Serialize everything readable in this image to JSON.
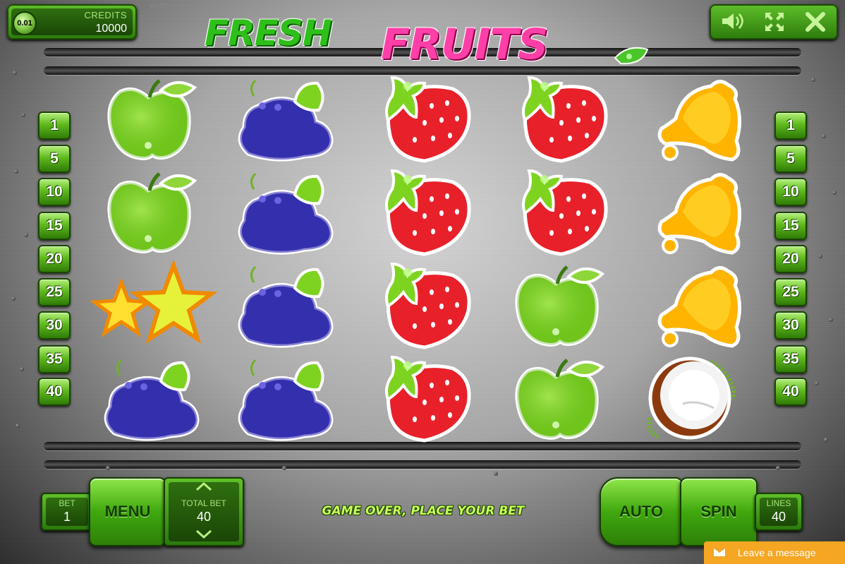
{
  "header": {
    "brand": "endorphina",
    "coin_value": "0.01",
    "credits_label": "CREDITS",
    "credits_value": "10000",
    "logo_word1": "FRESH",
    "logo_word2": "FRUITS",
    "controls": [
      {
        "name": "sound-icon",
        "glyph": "🔈"
      },
      {
        "name": "fullscreen-icon",
        "glyph": "⤢"
      },
      {
        "name": "close-icon",
        "glyph": "✕"
      }
    ]
  },
  "lines_left": [
    "1",
    "5",
    "10",
    "15",
    "20",
    "25",
    "30",
    "35",
    "40"
  ],
  "lines_right": [
    "1",
    "5",
    "10",
    "15",
    "20",
    "25",
    "30",
    "35",
    "40"
  ],
  "reels": [
    [
      "apple",
      "apple",
      "star",
      "grapes"
    ],
    [
      "grapes",
      "grapes",
      "grapes",
      "grapes"
    ],
    [
      "strawberry",
      "strawberry",
      "strawberry",
      "strawberry"
    ],
    [
      "strawberry",
      "strawberry",
      "apple",
      "apple"
    ],
    [
      "bell",
      "bell",
      "bell",
      "coconut"
    ]
  ],
  "bottom": {
    "bet_label": "BET",
    "bet_value": "1",
    "menu_label": "MENU",
    "total_bet_label": "TOTAL BET",
    "total_bet_value": "40",
    "status": "GAME OVER, PLACE YOUR BET",
    "auto_label": "AUTO",
    "spin_label": "SPIN",
    "lines_label": "LINES",
    "lines_value": "40"
  },
  "chat": {
    "label": "Leave a message"
  },
  "colors": {
    "accent_green": "#40a80f",
    "logo_pink": "#ff3fa8",
    "chat_orange": "#f5a623"
  }
}
